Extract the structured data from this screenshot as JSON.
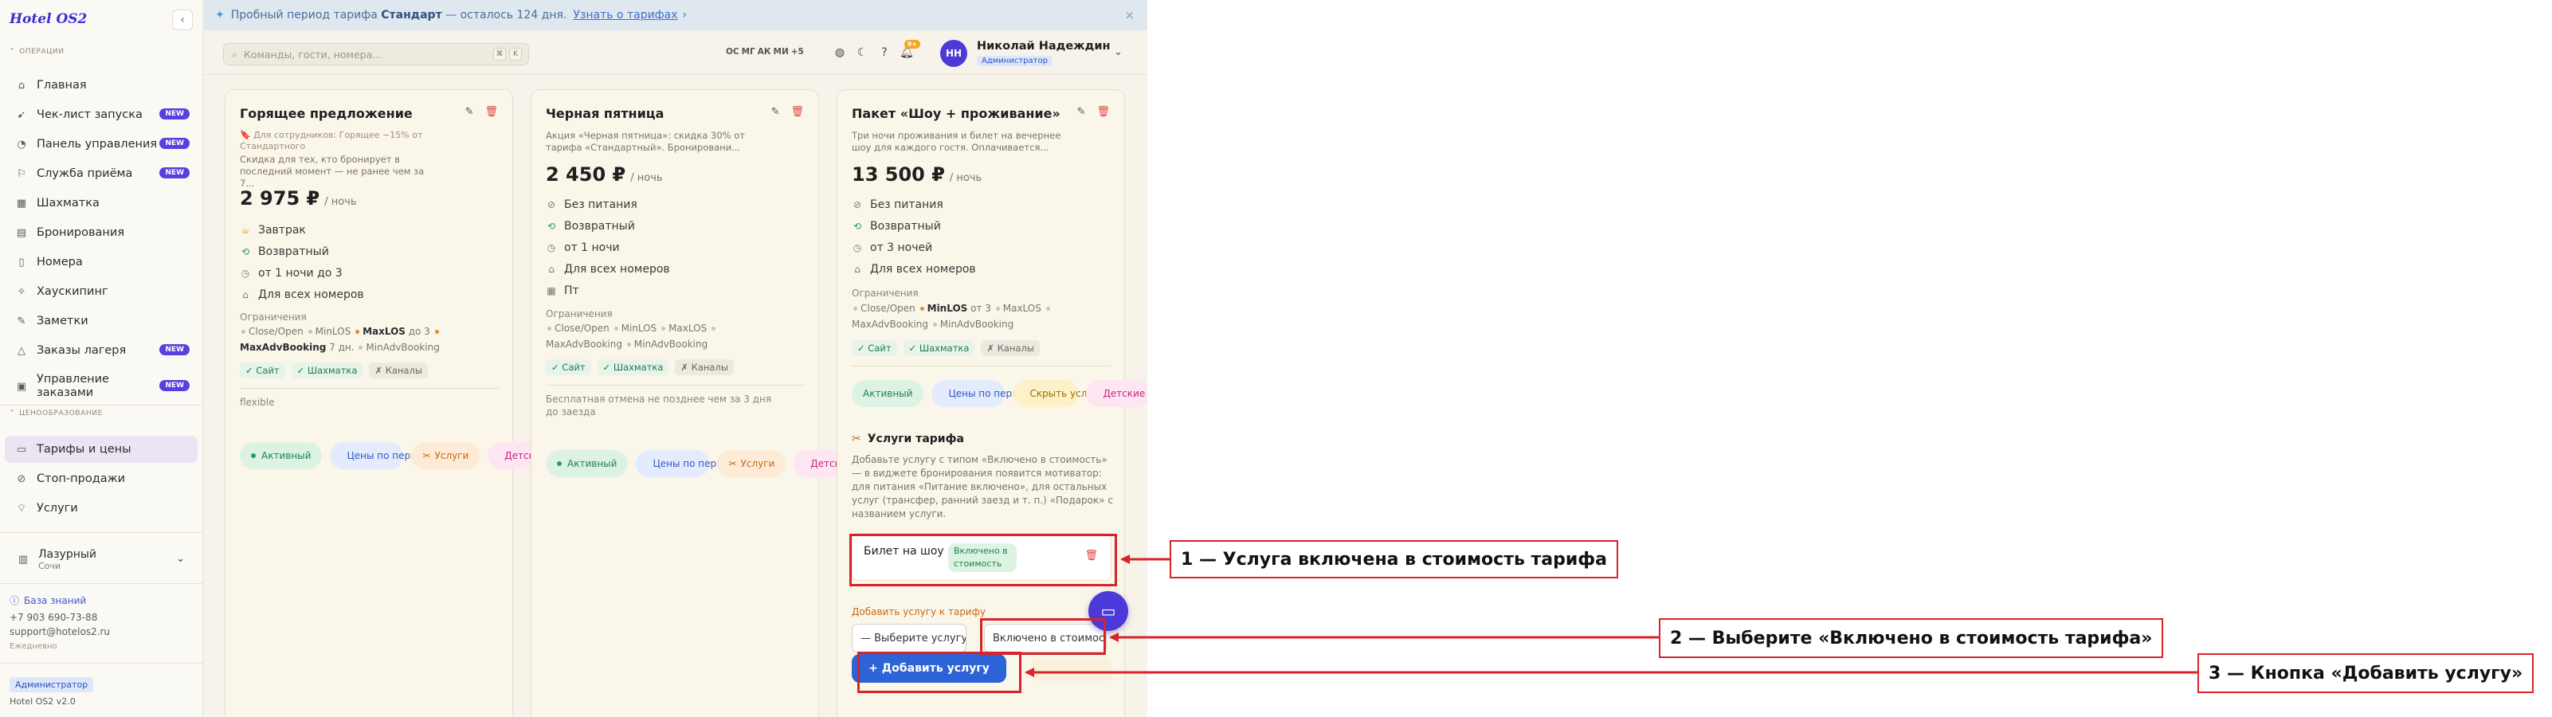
{
  "brand": "Hotel OS2",
  "sidebar": {
    "sections": {
      "operations": "ОПЕРАЦИИ",
      "pricing": "ЦЕНООБРАЗОВАНИЕ"
    },
    "items": [
      {
        "label": "Главная",
        "icon": "home-icon"
      },
      {
        "label": "Чек-лист запуска",
        "icon": "rocket-icon",
        "badge": "NEW"
      },
      {
        "label": "Панель управления",
        "icon": "gauge-icon",
        "badge": "NEW"
      },
      {
        "label": "Служба приёма",
        "icon": "reception-icon",
        "badge": "NEW"
      },
      {
        "label": "Шахматка",
        "icon": "grid-icon"
      },
      {
        "label": "Бронирования",
        "icon": "calendar-icon"
      },
      {
        "label": "Номера",
        "icon": "door-icon"
      },
      {
        "label": "Хаускипинг",
        "icon": "broom-icon"
      },
      {
        "label": "Заметки",
        "icon": "note-icon"
      },
      {
        "label": "Заказы лагеря",
        "icon": "tent-icon",
        "badge": "NEW"
      },
      {
        "label": "Управление заказами",
        "icon": "orders-icon",
        "badge": "NEW"
      },
      {
        "label": "Тарифы и цены",
        "icon": "tariff-icon",
        "active": true
      },
      {
        "label": "Стоп-продажи",
        "icon": "stop-icon"
      },
      {
        "label": "Услуги",
        "icon": "tag-icon"
      }
    ],
    "hotel": {
      "name": "Лазурный",
      "city": "Сочи"
    },
    "knowledge_base": "База знаний",
    "phone": "+7 903 690-73-88",
    "email": "support@hotelos2.ru",
    "hours": "Ежедневно",
    "role": "Администратор",
    "version": "Hotel OS2 v2.0"
  },
  "banner": {
    "prefix": "Пробный период тарифа",
    "plan": "Стандарт",
    "suffix": "— осталось 124 дня.",
    "link": "Узнать о тарифах"
  },
  "header": {
    "search_placeholder": "Команды, гости, номера...",
    "shortcut_1": "⌘",
    "shortcut_2": "K",
    "presence": [
      "ОС",
      "МГ",
      "АК",
      "МИ",
      "+5"
    ],
    "notifications": "9+",
    "user_initials": "НН",
    "user_name": "Николай Надеждин",
    "user_role": "Администратор"
  },
  "cards": [
    {
      "title": "Горящее предложение",
      "desc_line1": "🔖 Для сотрудников: Горящее −15% от Стандартного",
      "desc_line2": "Скидка для тех, кто бронирует в последний момент — не ранее чем за 7...",
      "price": "2 975 ₽",
      "price_unit": "/ ночь",
      "features": [
        "Завтрак",
        "Возвратный",
        "от 1 ночи до 3",
        "Для всех номеров"
      ],
      "restrictions_label": "Ограничения",
      "restrictions": [
        {
          "name": "Close/Open",
          "on": false,
          "extra": ""
        },
        {
          "name": "MinLOS",
          "on": false,
          "extra": ""
        },
        {
          "name": "MaxLOS",
          "on": true,
          "extra": "до 3"
        },
        {
          "name": "MaxAdvBooking",
          "on": true,
          "extra": "7 дн."
        },
        {
          "name": "MinAdvBooking",
          "on": false,
          "extra": ""
        }
      ],
      "channels": [
        {
          "label": "✓ Сайт",
          "ok": true
        },
        {
          "label": "✓ Шахматка",
          "ok": true
        },
        {
          "label": "✗ Каналы",
          "ok": false
        }
      ],
      "note": "flexible",
      "tabs": [
        {
          "label": "Активный",
          "color": "green"
        },
        {
          "label": "Цены по периодам",
          "color": "blue"
        },
        {
          "label": "Услуги",
          "color": "orange"
        },
        {
          "label": "Детские цены",
          "color": "pink"
        }
      ]
    },
    {
      "title": "Черная пятница",
      "desc_line1": "Акция «Черная пятница»: скидка 30% от тарифа «Стандартный». Бронировани...",
      "price": "2 450 ₽",
      "price_unit": "/ ночь",
      "features": [
        "Без питания",
        "Возвратный",
        "от 1 ночи",
        "Для всех номеров",
        "Пт"
      ],
      "restrictions_label": "Ограничения",
      "restrictions": [
        {
          "name": "Close/Open",
          "on": false,
          "extra": ""
        },
        {
          "name": "MinLOS",
          "on": false,
          "extra": ""
        },
        {
          "name": "MaxLOS",
          "on": false,
          "extra": ""
        },
        {
          "name": "MaxAdvBooking",
          "on": false,
          "extra": ""
        },
        {
          "name": "MinAdvBooking",
          "on": false,
          "extra": ""
        }
      ],
      "channels": [
        {
          "label": "✓ Сайт",
          "ok": true
        },
        {
          "label": "✓ Шахматка",
          "ok": true
        },
        {
          "label": "✗ Каналы",
          "ok": false
        }
      ],
      "note": "Бесплатная отмена не позднее чем за 3 дня до заезда",
      "tabs": [
        {
          "label": "Активный",
          "color": "green"
        },
        {
          "label": "Цены по периодам",
          "color": "blue"
        },
        {
          "label": "Услуги",
          "color": "orange"
        },
        {
          "label": "Детские цены",
          "color": "pink"
        }
      ]
    },
    {
      "title": "Пакет «Шоу + проживание»",
      "desc_line1": "Три ночи проживания и билет на вечернее шоу для каждого гостя. Оплачивается...",
      "price": "13 500 ₽",
      "price_unit": "/ ночь",
      "features": [
        "Без питания",
        "Возвратный",
        "от 3 ночей",
        "Для всех номеров"
      ],
      "restrictions_label": "Ограничения",
      "restrictions": [
        {
          "name": "Close/Open",
          "on": false,
          "extra": ""
        },
        {
          "name": "MinLOS",
          "on": true,
          "extra": "от 3"
        },
        {
          "name": "MaxLOS",
          "on": false,
          "extra": ""
        },
        {
          "name": "MaxAdvBooking",
          "on": false,
          "extra": ""
        },
        {
          "name": "MinAdvBooking",
          "on": false,
          "extra": ""
        }
      ],
      "channels": [
        {
          "label": "✓ Сайт",
          "ok": true
        },
        {
          "label": "✓ Шахматка",
          "ok": true
        },
        {
          "label": "✗ Каналы",
          "ok": false
        }
      ],
      "tabs": [
        {
          "label": "Активный",
          "color": "green"
        },
        {
          "label": "Цены по периодам",
          "color": "blue"
        },
        {
          "label": "Скрыть услуги",
          "color": "yellow"
        },
        {
          "label": "Детские цены",
          "color": "pink"
        }
      ],
      "services": {
        "title": "Услуги тарифа",
        "desc": "Добавьте услугу с типом «Включено в стоимость» — в виджете бронирования появится мотиватор: для питания «Питание включено», для остальных услуг (трансфер, ранний заезд и т. п.) «Подарок» с названием услуги.",
        "item_name": "Билет на шоу",
        "item_badge": "Включено в стоимость",
        "add_label": "Добавить услугу к тарифу",
        "service_select": "— Выберите услугу —",
        "type_select": "Включено в стоимость",
        "add_button": "+ Добавить услугу"
      }
    }
  ],
  "annotations": [
    {
      "num": "1",
      "text": "1 — Услуга включена в стоимость тарифа"
    },
    {
      "num": "2",
      "text": "2 — Выберите «Включено в стоимость тарифа»"
    },
    {
      "num": "3",
      "text": "3 — Кнопка «Добавить услугу»"
    }
  ],
  "colors": {
    "annotation": "#d8232a",
    "accent": "#4c3ad8",
    "primary_button": "#2c64d7"
  }
}
